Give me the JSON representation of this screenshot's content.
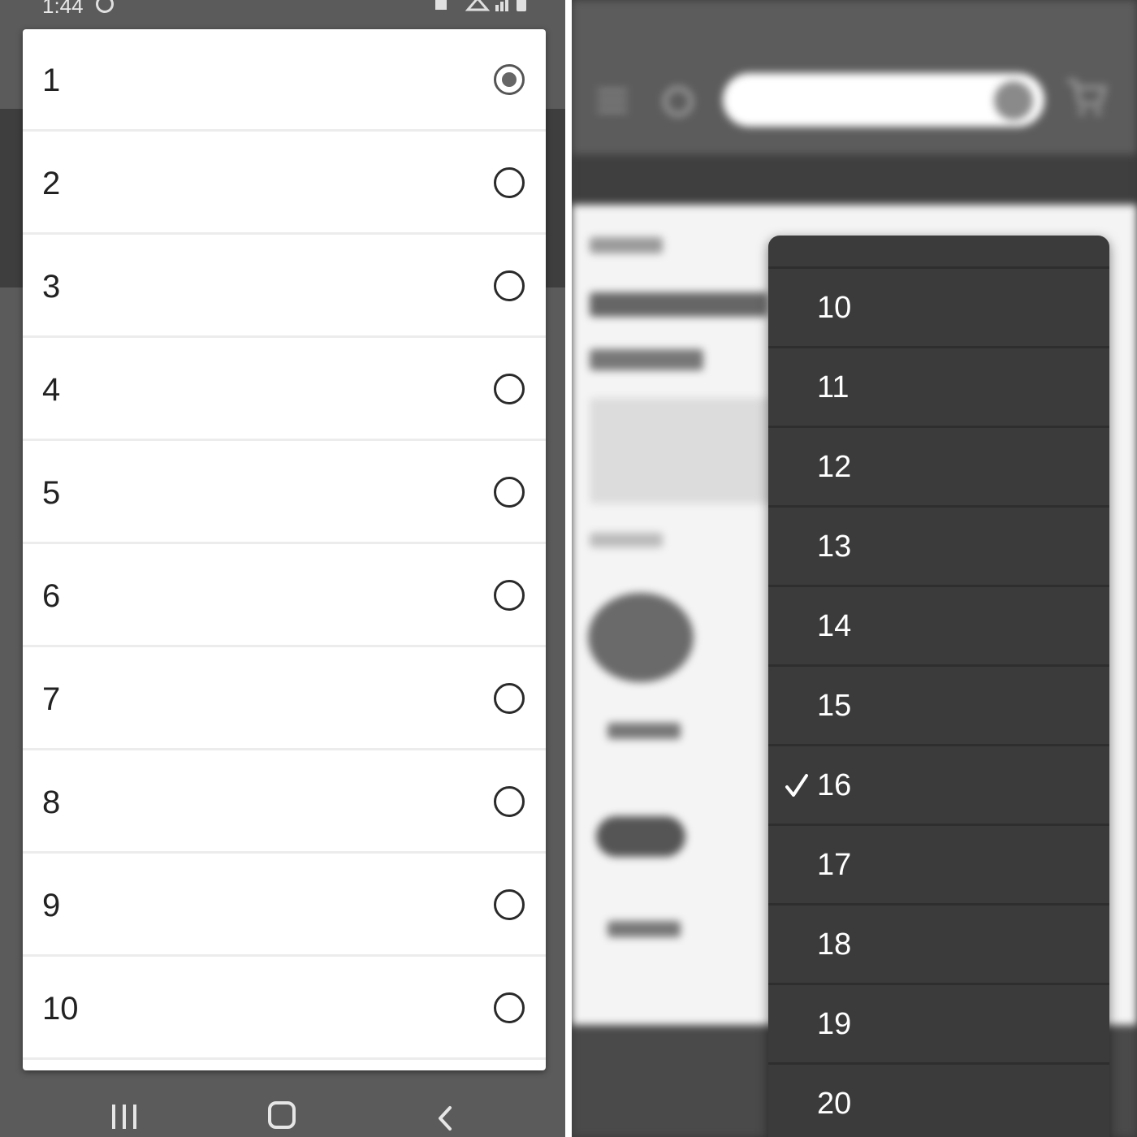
{
  "left_panel": {
    "status_bar": {
      "time": "1:44"
    },
    "options": [
      {
        "label": "1",
        "selected": true
      },
      {
        "label": "2",
        "selected": false
      },
      {
        "label": "3",
        "selected": false
      },
      {
        "label": "4",
        "selected": false
      },
      {
        "label": "5",
        "selected": false
      },
      {
        "label": "6",
        "selected": false
      },
      {
        "label": "7",
        "selected": false
      },
      {
        "label": "8",
        "selected": false
      },
      {
        "label": "9",
        "selected": false
      },
      {
        "label": "10",
        "selected": false
      }
    ],
    "nav_icons": [
      "recents-icon",
      "home-icon",
      "back-icon"
    ]
  },
  "right_panel": {
    "picker_items": [
      {
        "label": "10",
        "selected": false
      },
      {
        "label": "11",
        "selected": false
      },
      {
        "label": "12",
        "selected": false
      },
      {
        "label": "13",
        "selected": false
      },
      {
        "label": "14",
        "selected": false
      },
      {
        "label": "15",
        "selected": false
      },
      {
        "label": "16",
        "selected": true
      },
      {
        "label": "17",
        "selected": false
      },
      {
        "label": "18",
        "selected": false
      },
      {
        "label": "19",
        "selected": false
      },
      {
        "label": "20",
        "selected": false
      }
    ],
    "background_icons": [
      "menu-icon",
      "gear-icon",
      "search-icon",
      "cart-icon"
    ]
  },
  "colors": {
    "android_dim": "#5b5b5b",
    "dialog_bg": "#ffffff",
    "picker_bg": "#3b3b3b",
    "picker_text": "#ffffff"
  }
}
